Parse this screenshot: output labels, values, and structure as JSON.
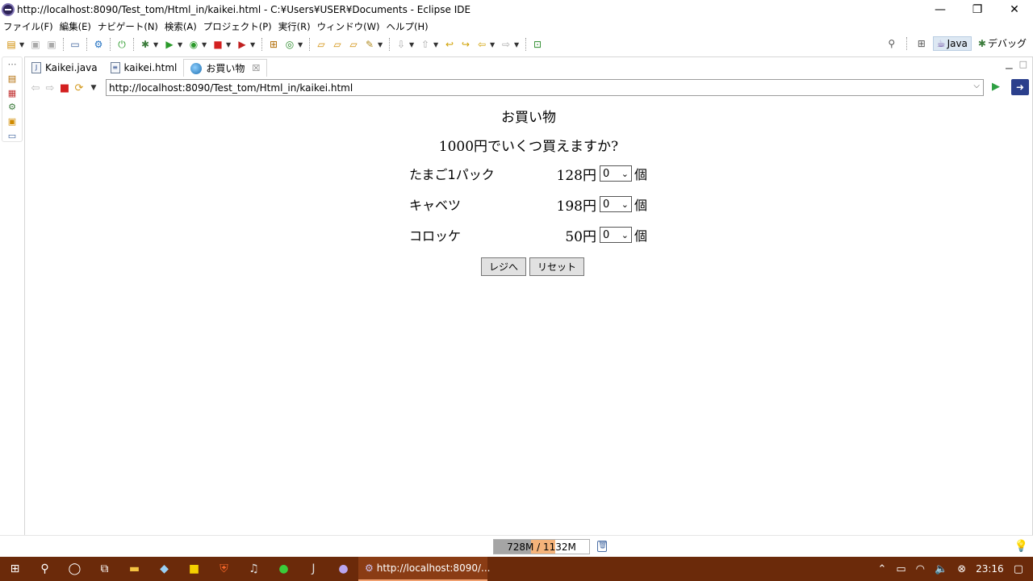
{
  "window": {
    "title": "http://localhost:8090/Test_tom/Html_in/kaikei.html - C:¥Users¥USER¥Documents - Eclipse IDE",
    "minimize": "—",
    "maximize": "❐",
    "close": "✕"
  },
  "menu": [
    "ファイル(F)",
    "編集(E)",
    "ナビゲート(N)",
    "検索(A)",
    "プロジェクト(P)",
    "実行(R)",
    "ウィンドウ(W)",
    "ヘルプ(H)"
  ],
  "toolbar": {
    "perspectives": [
      {
        "label": "Java",
        "active": true
      },
      {
        "label": "デバッグ",
        "active": false
      }
    ]
  },
  "editor": {
    "tabs": [
      {
        "label": "Kaikei.java",
        "icon": "java-file-icon",
        "active": false
      },
      {
        "label": "kaikei.html",
        "icon": "html-file-icon",
        "active": false
      },
      {
        "label": "お買い物",
        "icon": "globe-icon",
        "active": true
      }
    ]
  },
  "browser": {
    "url": "http://localhost:8090/Test_tom/Html_in/kaikei.html"
  },
  "page": {
    "heading": "お買い物",
    "question": "1000円でいくつ買えますか?",
    "items": [
      {
        "name": "たまご1パック",
        "price": "128円",
        "qty": "0",
        "unit": "個"
      },
      {
        "name": "キャベツ",
        "price": "198円",
        "qty": "0",
        "unit": "個"
      },
      {
        "name": "コロッケ",
        "price": "50円",
        "qty": "0",
        "unit": "個"
      }
    ],
    "submit_label": "レジへ",
    "reset_label": "リセット"
  },
  "status": {
    "heap_label": "728M / 1132M",
    "heap_used_fraction": 0.643
  },
  "taskbar": {
    "active_app": "http://localhost:8090/...",
    "clock": "23:16"
  },
  "colors": {
    "taskbar": "#6b2a0a",
    "heap_used": "#a5a5a5",
    "heap_committed": "#f5b37a"
  }
}
